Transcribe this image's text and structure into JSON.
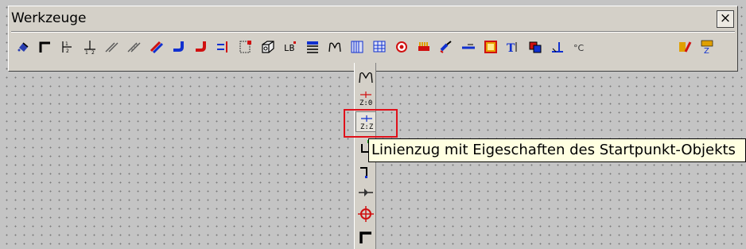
{
  "window": {
    "title": "Werkzeuge",
    "close_label": "×"
  },
  "toolbar": {
    "tools": [
      "bucket-icon",
      "angle-icon",
      "dim-horizontal-icon",
      "dim-vertical-icon",
      "double-line-icon",
      "double-line-hatched-icon",
      "pipe-blue-red-icon",
      "pipe-elbow-blue-icon",
      "pipe-elbow-red-icon",
      "distributor-icon",
      "grid-table-icon",
      "cube-icon",
      "text-block-icon",
      "lines-stack-icon",
      "polyline-icon",
      "column-grid-icon",
      "table-icon",
      "circle-point-icon",
      "heater-icon",
      "brush-icon",
      "line-tool-icon",
      "rectangle-icon",
      "text-tool-icon",
      "copy-tool-icon",
      "dimension-arrow-icon",
      "temperature-icon",
      "layer-color-icon",
      "formula-icon"
    ]
  },
  "flyout": {
    "items": [
      {
        "name": "polyline-icon"
      },
      {
        "name": "zero-value-icon",
        "label": "Z:0"
      },
      {
        "name": "start-point-properties-icon",
        "label": "Z:Z"
      },
      {
        "name": "line-to-point-icon"
      },
      {
        "name": "step-line-icon"
      },
      {
        "name": "arrow-through-icon"
      },
      {
        "name": "crosshair-icon"
      },
      {
        "name": "corner-line-icon"
      }
    ]
  },
  "tooltip": {
    "text": "Linienzug mit Eigeschaften des Startpunkt-Objekts"
  }
}
